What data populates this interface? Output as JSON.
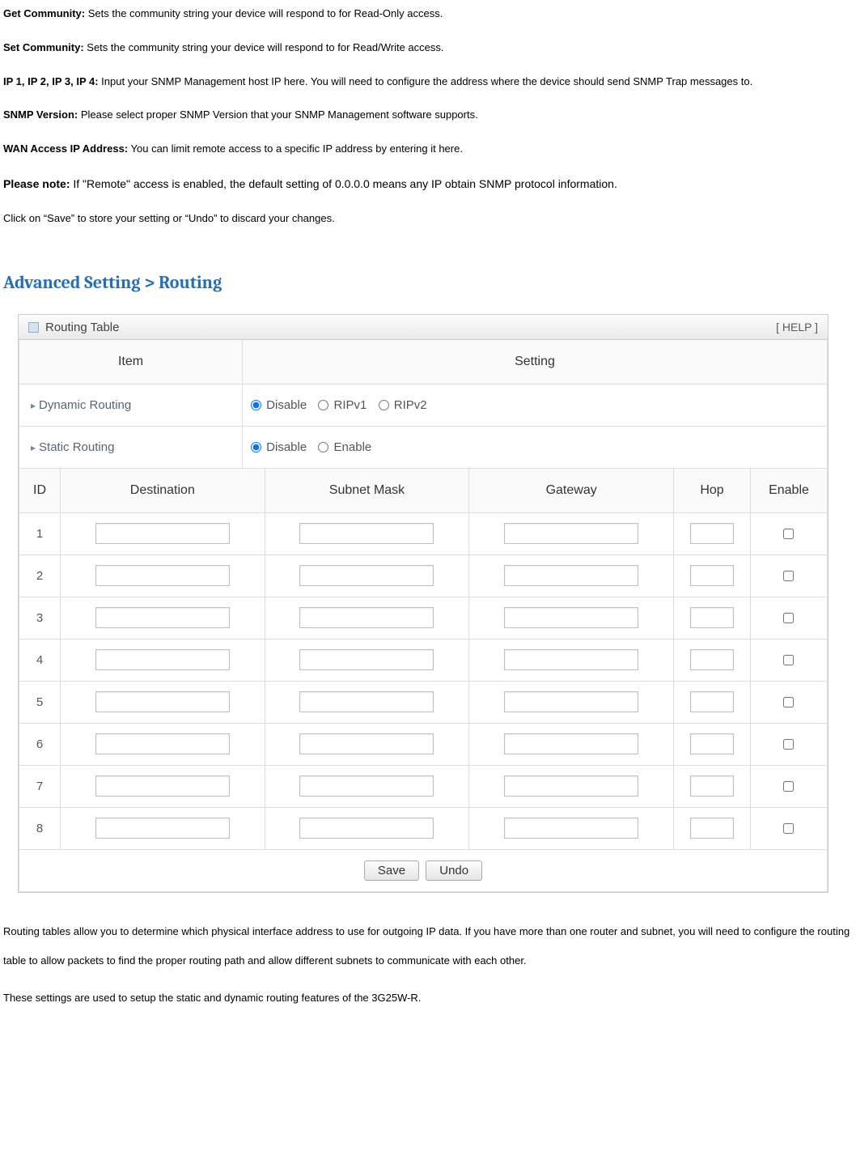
{
  "defs": [
    {
      "label": "Get Community:",
      "text": " Sets the community string your device will respond to for Read-Only access."
    },
    {
      "label": "Set Community:",
      "text": " Sets the community string your device will respond to for Read/Write access."
    },
    {
      "label": "IP 1, IP 2, IP 3, IP 4:",
      "text": " Input your SNMP Management host IP here. You will need to configure the address where the device should send SNMP Trap messages to."
    },
    {
      "label": "SNMP Version:",
      "text": " Please select proper SNMP Version that your SNMP Management software supports."
    },
    {
      "label": "WAN Access IP Address:",
      "text": " You can limit remote access to a specific IP address by entering it here."
    }
  ],
  "note": {
    "label": "Please note:",
    "text": " If \"Remote\" access is enabled, the default setting of 0.0.0.0 means any IP obtain SNMP protocol information."
  },
  "save_hint": "Click on “Save” to store your setting or “Undo” to discard your changes.",
  "heading": "Advanced Setting > Routing",
  "panel": {
    "title": "Routing Table",
    "help": "[ HELP ]",
    "head_item": "Item",
    "head_setting": "Setting",
    "dynamic_label": "Dynamic Routing",
    "static_label": "Static Routing",
    "opts_dynamic": {
      "disable": "Disable",
      "ripv1": "RIPv1",
      "ripv2": "RIPv2"
    },
    "opts_static": {
      "disable": "Disable",
      "enable": "Enable"
    }
  },
  "routes": {
    "cols": {
      "id": "ID",
      "dest": "Destination",
      "mask": "Subnet Mask",
      "gw": "Gateway",
      "hop": "Hop",
      "en": "Enable"
    },
    "rows": [
      {
        "id": "1"
      },
      {
        "id": "2"
      },
      {
        "id": "3"
      },
      {
        "id": "4"
      },
      {
        "id": "5"
      },
      {
        "id": "6"
      },
      {
        "id": "7"
      },
      {
        "id": "8"
      }
    ]
  },
  "buttons": {
    "save": "Save",
    "undo": "Undo"
  },
  "after": [
    "Routing tables allow you to determine which physical interface address to use for outgoing IP data. If you have more than one router and subnet, you will need to configure the routing table to allow packets to find the proper routing path and allow different subnets to communicate with each other.",
    "These settings are used to setup the static and dynamic routing features of the 3G25W-R."
  ]
}
